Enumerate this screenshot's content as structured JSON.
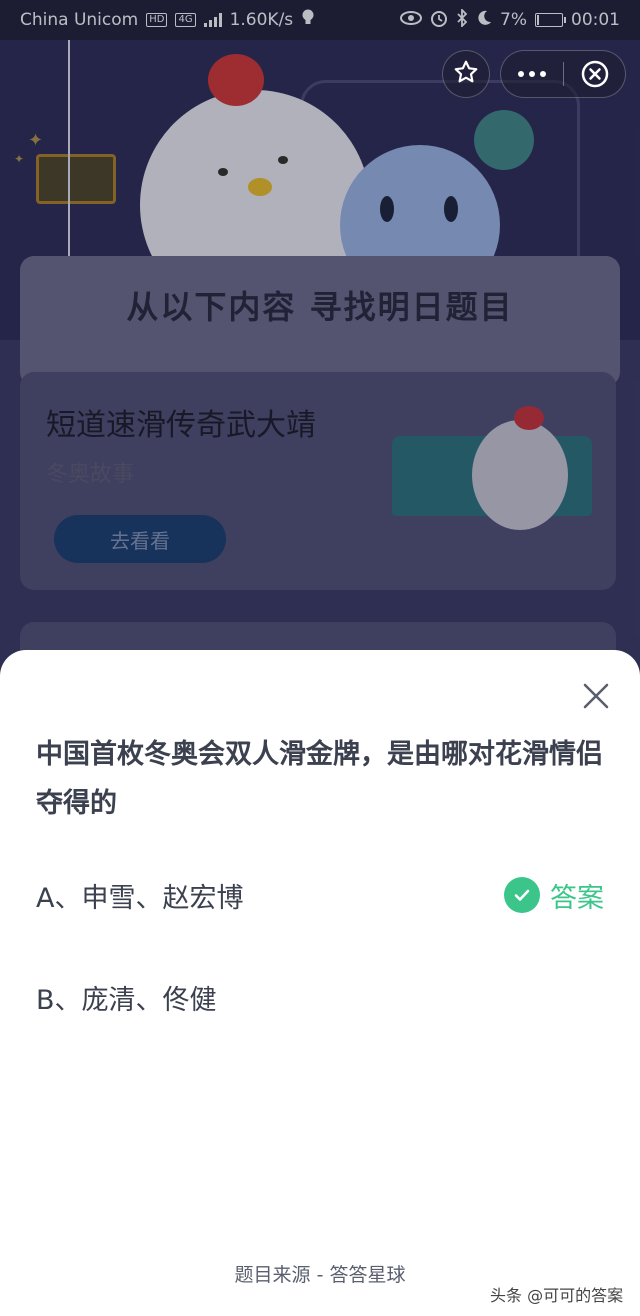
{
  "status_bar": {
    "carrier": "China Unicom",
    "hd_badge": "HD",
    "network_badge": "4G",
    "speed": "1.60K/s",
    "battery": "7%",
    "battery_level": 0.07,
    "time": "00:01",
    "icons": [
      "signal-icon",
      "bulb-icon",
      "eye-icon",
      "alarm-icon",
      "bluetooth-icon",
      "moon-icon",
      "battery-icon"
    ]
  },
  "background": {
    "banner_title": "从以下内容  寻找明日题目",
    "card1": {
      "title": "短道速滑传奇武大靖",
      "subtitle": "冬奥故事",
      "button": "去看看"
    },
    "card2": {
      "title": "中国首枚冬奥会双人滑金牌，是由哪对花"
    }
  },
  "capsule": {
    "icons": [
      "star-icon",
      "more-icon",
      "close-circle-icon"
    ]
  },
  "sheet": {
    "question": "中国首枚冬奥会双人滑金牌，是由哪对花滑情侣夺得的",
    "options": [
      {
        "text": "A、申雪、赵宏博",
        "is_answer": true
      },
      {
        "text": "B、庞清、佟健",
        "is_answer": false
      }
    ],
    "answer_label": "答案",
    "source": "题目来源 - 答答星球"
  },
  "watermark": "头条 @可可的答案",
  "colors": {
    "accent": "#3cc58a",
    "text": "#3c4150",
    "button_blue": "#1d3e70"
  }
}
